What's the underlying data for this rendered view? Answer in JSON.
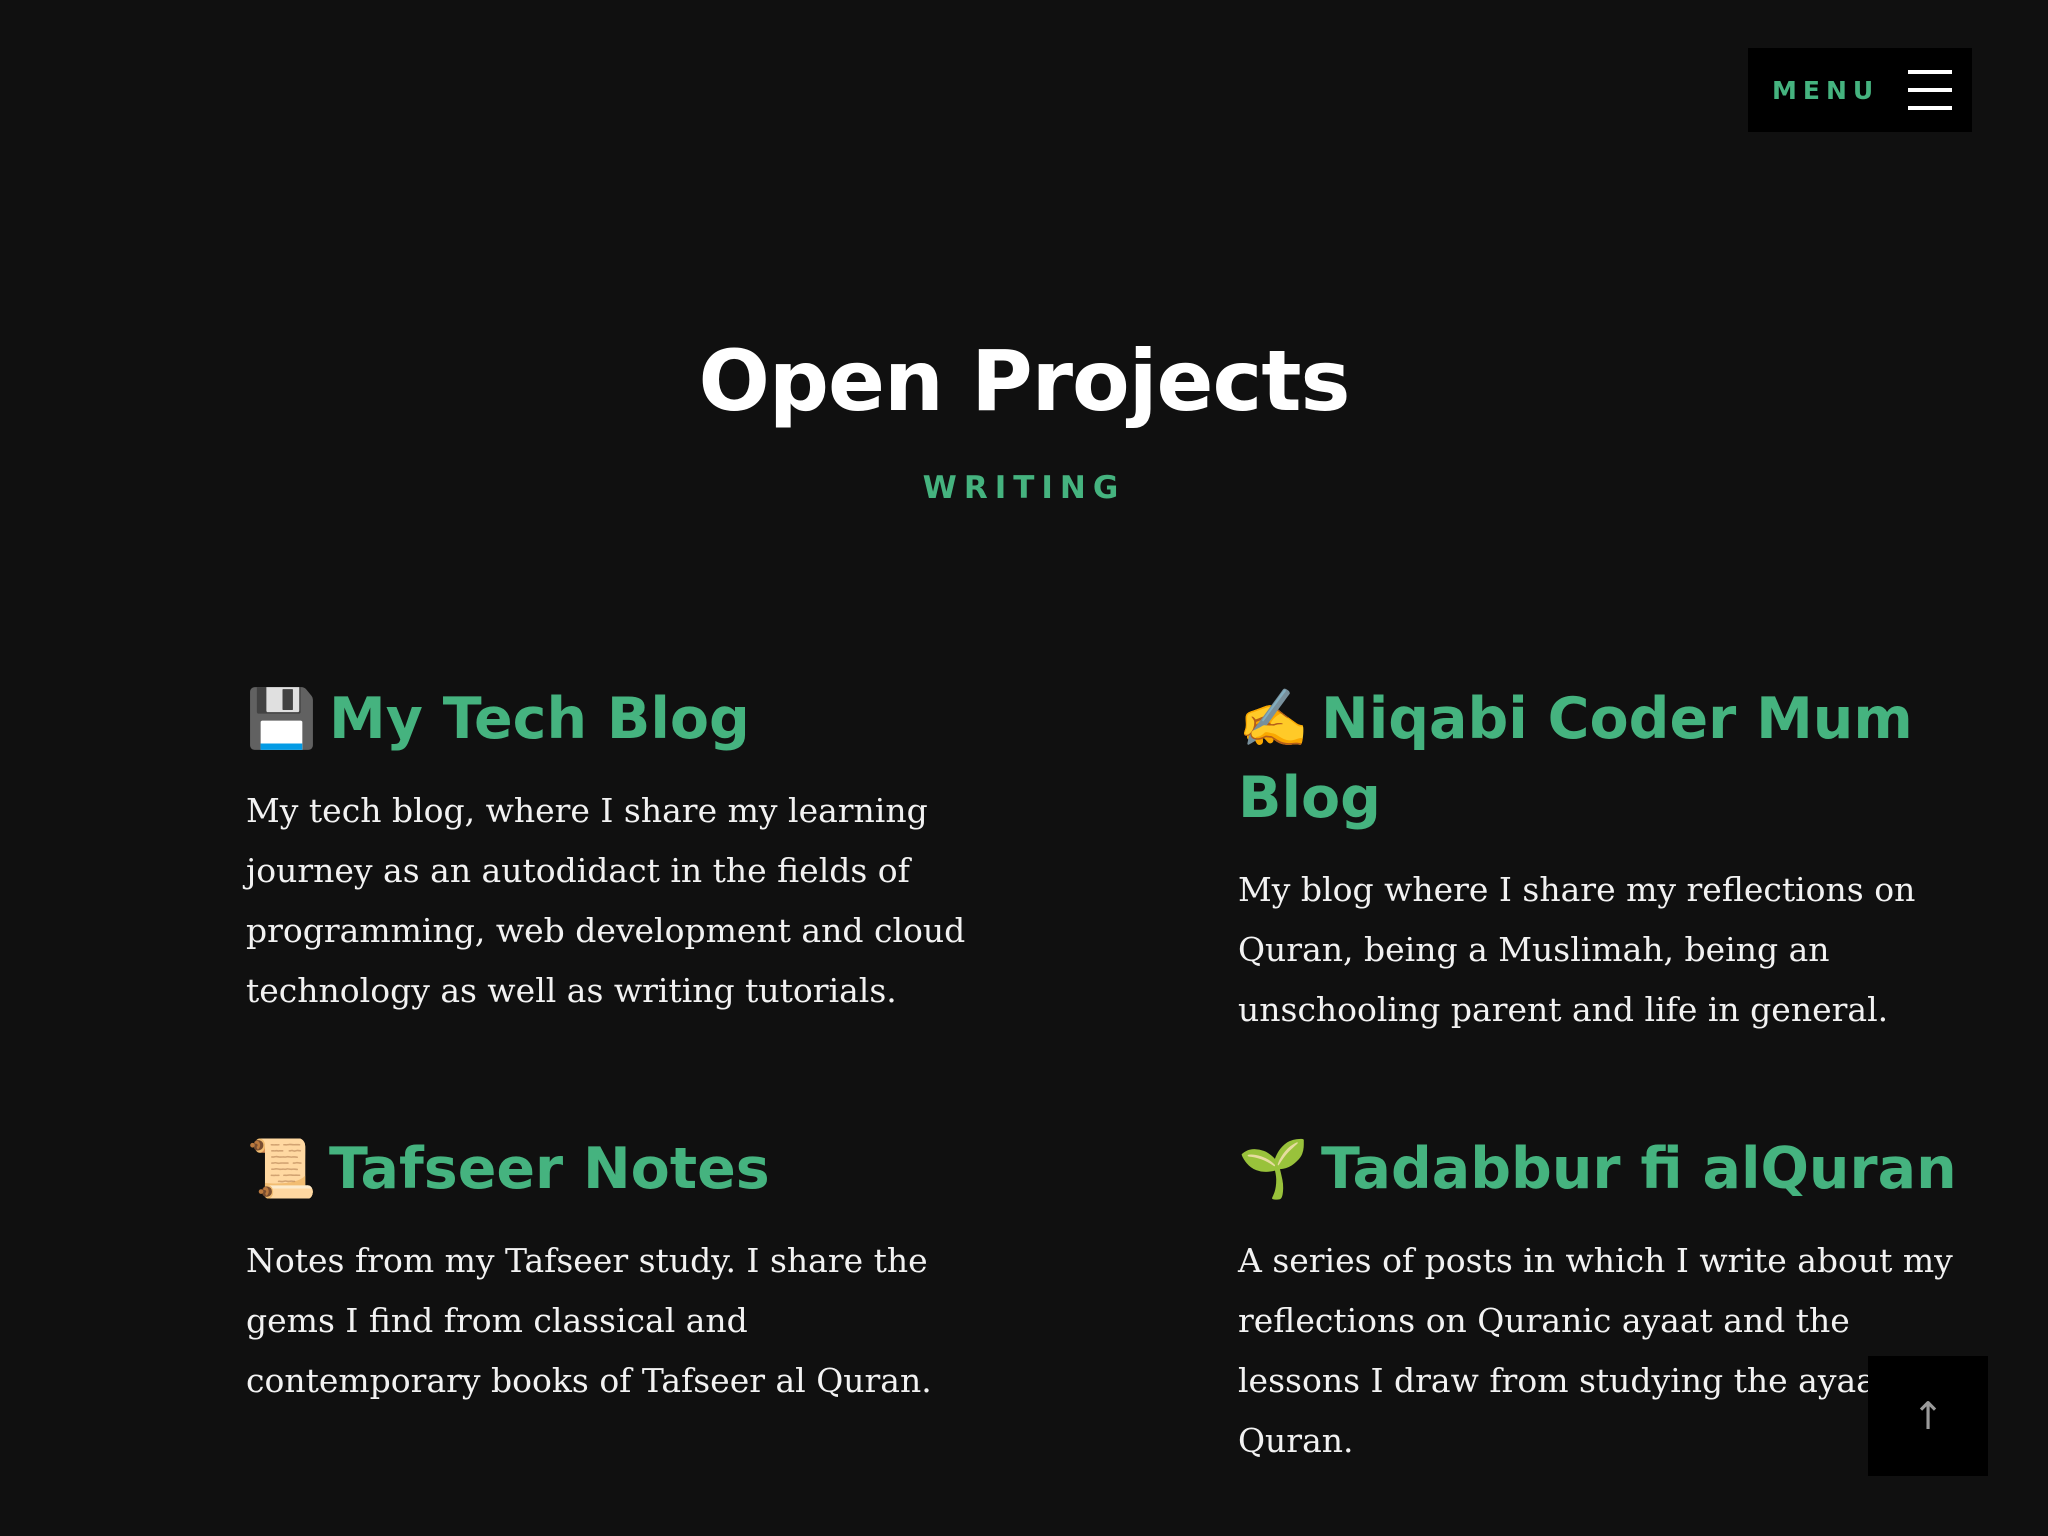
{
  "header": {
    "menu_label": "MENU"
  },
  "hero": {
    "title": "Open Projects",
    "subtitle": "WRITING"
  },
  "projects": [
    {
      "emoji": "💾",
      "title": "My Tech Blog",
      "description": "My tech blog, where I share my learning journey as an autodidact in the fields of programming, web development and cloud technology as well as writing tutorials."
    },
    {
      "emoji": "✍️",
      "title": "Niqabi Coder Mum Blog",
      "description": "My blog where I share my reflections on Quran, being a Muslimah, being an unschooling parent and life in general."
    },
    {
      "emoji": "📜",
      "title": "Tafseer Notes",
      "description": "Notes from my Tafseer study. I share the gems I find from classical and contemporary books of Tafseer al Quran."
    },
    {
      "emoji": "🌱",
      "title": "Tadabbur fi alQuran",
      "description": "A series of posts in which I write about my reflections on Quranic ayaat and the lessons I draw from studying the ayaat of Quran."
    }
  ],
  "scroll_to_top": {
    "icon_glyph": "↑"
  },
  "colors": {
    "background": "#101010",
    "accent": "#45b37f",
    "text": "#f2f2f2",
    "button_bg": "#000000"
  }
}
